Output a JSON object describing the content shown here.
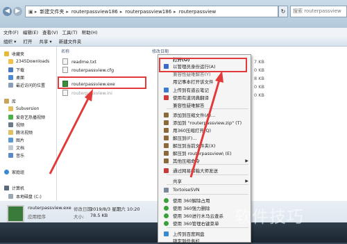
{
  "address": {
    "crumbs": [
      "新建文件夹",
      "routerpassview186",
      "routerpassview186",
      "routerpassview"
    ],
    "search_placeholder": "搜索 routerpassview"
  },
  "menubar": [
    "文件(F)",
    "编辑(E)",
    "查看(V)",
    "工具(T)",
    "帮助(H)"
  ],
  "toolbar": [
    "组织 ▾",
    "打开",
    "共享 ▾",
    "新建文件夹"
  ],
  "nav": {
    "favorites": "收藏夹",
    "items": [
      "2345Downloads",
      "下载",
      "桌面",
      "最近访问的位置"
    ],
    "library": "库",
    "lib_items": [
      "Subversion",
      "爱奇艺热播视频",
      "视频",
      "腾讯视频",
      "图片",
      "文档",
      "音乐"
    ],
    "homegroup": "家庭组",
    "computer": "计算机",
    "local_disk": "本地磁盘 (C:)"
  },
  "files": {
    "col_name": "名称",
    "col_date": "修改日期",
    "items": [
      {
        "name": "readme.txt",
        "size": "7 KB"
      },
      {
        "name": "routerpassview.cfg",
        "size": "0 KB"
      },
      {
        "name": "",
        "size": ""
      },
      {
        "name": "routerpassview.exe",
        "size": "0 KB"
      },
      {
        "name": "routerpassview.ini",
        "size": "0 KB"
      }
    ],
    "extra_sizes": [
      "8 KB"
    ]
  },
  "context_menu": {
    "open": "打开(O)",
    "run_as_admin": "以管理员身份运行(A)",
    "compat": "兼容性疑难解答(Y)",
    "notepad": "用记事本打开该文件",
    "youdao_upload": "上传到有道云笔记",
    "youdao_translate": "使用有道词典翻译",
    "compat_fix": "兼容性疑难解答",
    "add_archive": "添加到压缩文件(A)...",
    "add_zip": "添加到 \"routerpassview.zip\" (T)",
    "open_360zip": "用360压缩打开(Q)",
    "extract_to": "解压到(F)...",
    "extract_here": "解压到当前文件夹(X)",
    "extract_folder": "解压到 routerpassview\\ (E)",
    "other_cmds": "其他压缩命令",
    "netease": "通过网易邮箱大师发送",
    "share": "共享",
    "tortoise": "TortoiseSVN",
    "unlock_360": "使用 360解除占用",
    "delete_360": "使用 360强力删除",
    "scan_360": "使用 360进行木马云查杀",
    "manage_360": "使用 360管理右键菜单",
    "baidu": "上传到百度网盘",
    "pin": "锁定到任务栏"
  },
  "details": {
    "name": "routerpassview.exe",
    "modified_label": "修改日期:",
    "modified": "2019/8/3 星期六 10:20",
    "type": "应用程序",
    "size_label": "大小:",
    "size": "78.5 KB"
  },
  "watermark": "软件技巧",
  "colors": {
    "highlight": "#e23a3a",
    "window_chrome": "#c9dbe8"
  }
}
